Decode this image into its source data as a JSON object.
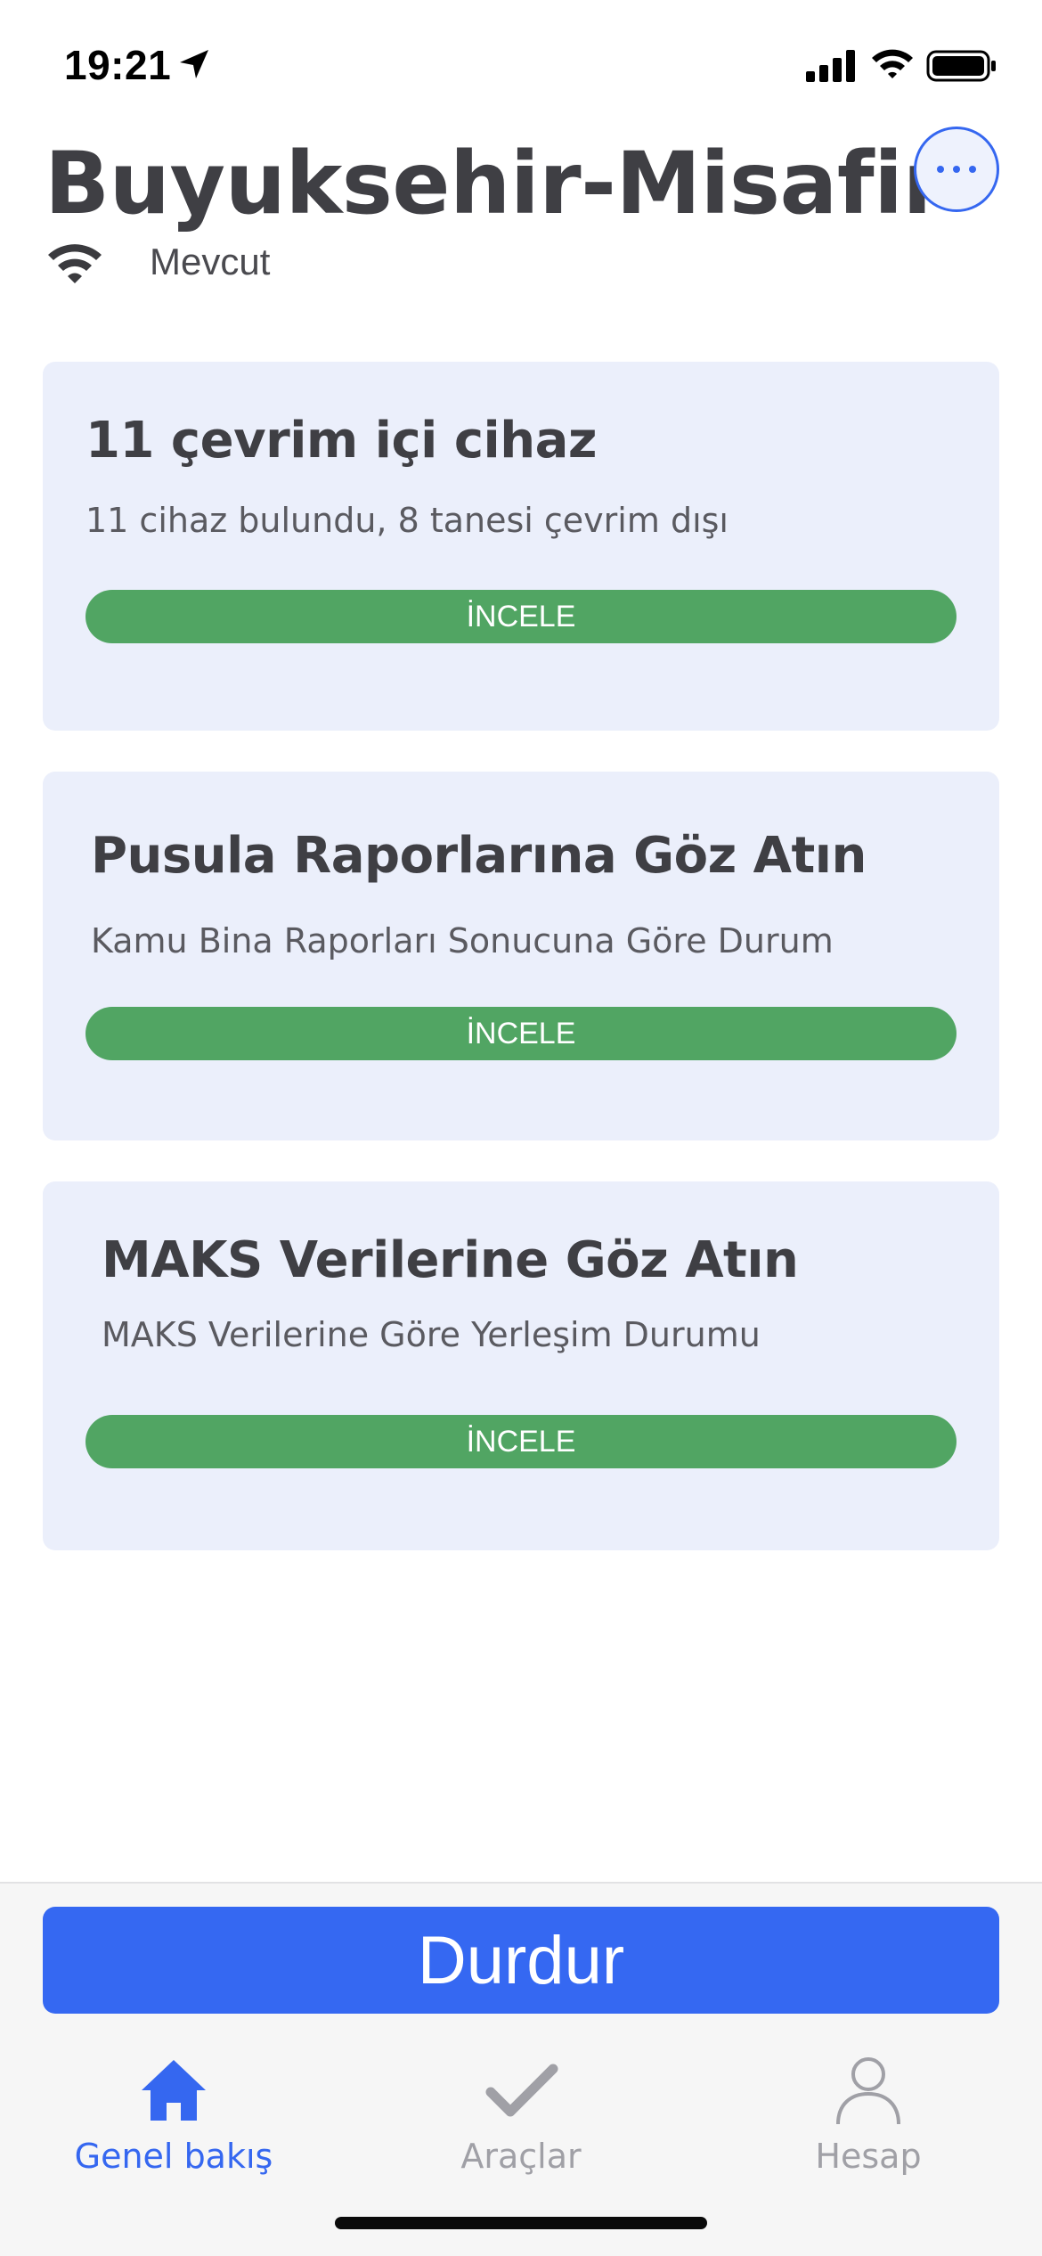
{
  "status_bar": {
    "time": "19:21"
  },
  "header": {
    "title": "Buyuksehir-Misafir",
    "network_status": "Mevcut"
  },
  "cards": [
    {
      "title": "11 çevrim içi cihaz",
      "subtitle": "11 cihaz bulundu, 8 tanesi çevrim dışı",
      "button_label": "İNCELE"
    },
    {
      "title": "Pusula Raporlarına Göz Atın",
      "subtitle": "Kamu Bina Raporları Sonucuna Göre Durum",
      "button_label": "İNCELE"
    },
    {
      "title": "MAKS Verilerine Göz Atın",
      "subtitle": "MAKS Verilerine Göre Yerleşim Durumu",
      "button_label": "İNCELE"
    }
  ],
  "stop_button_label": "Durdur",
  "tab_bar": {
    "tabs": [
      {
        "label": "Genel bakış",
        "icon": "home-icon",
        "active": true
      },
      {
        "label": "Araçlar",
        "icon": "checkmark-icon",
        "active": false
      },
      {
        "label": "Hesap",
        "icon": "person-icon",
        "active": false
      }
    ]
  },
  "colors": {
    "accent": "#3567f0",
    "card_background": "#ebeffb",
    "button_green": "#51a563",
    "stop_button": "#3568f2"
  }
}
